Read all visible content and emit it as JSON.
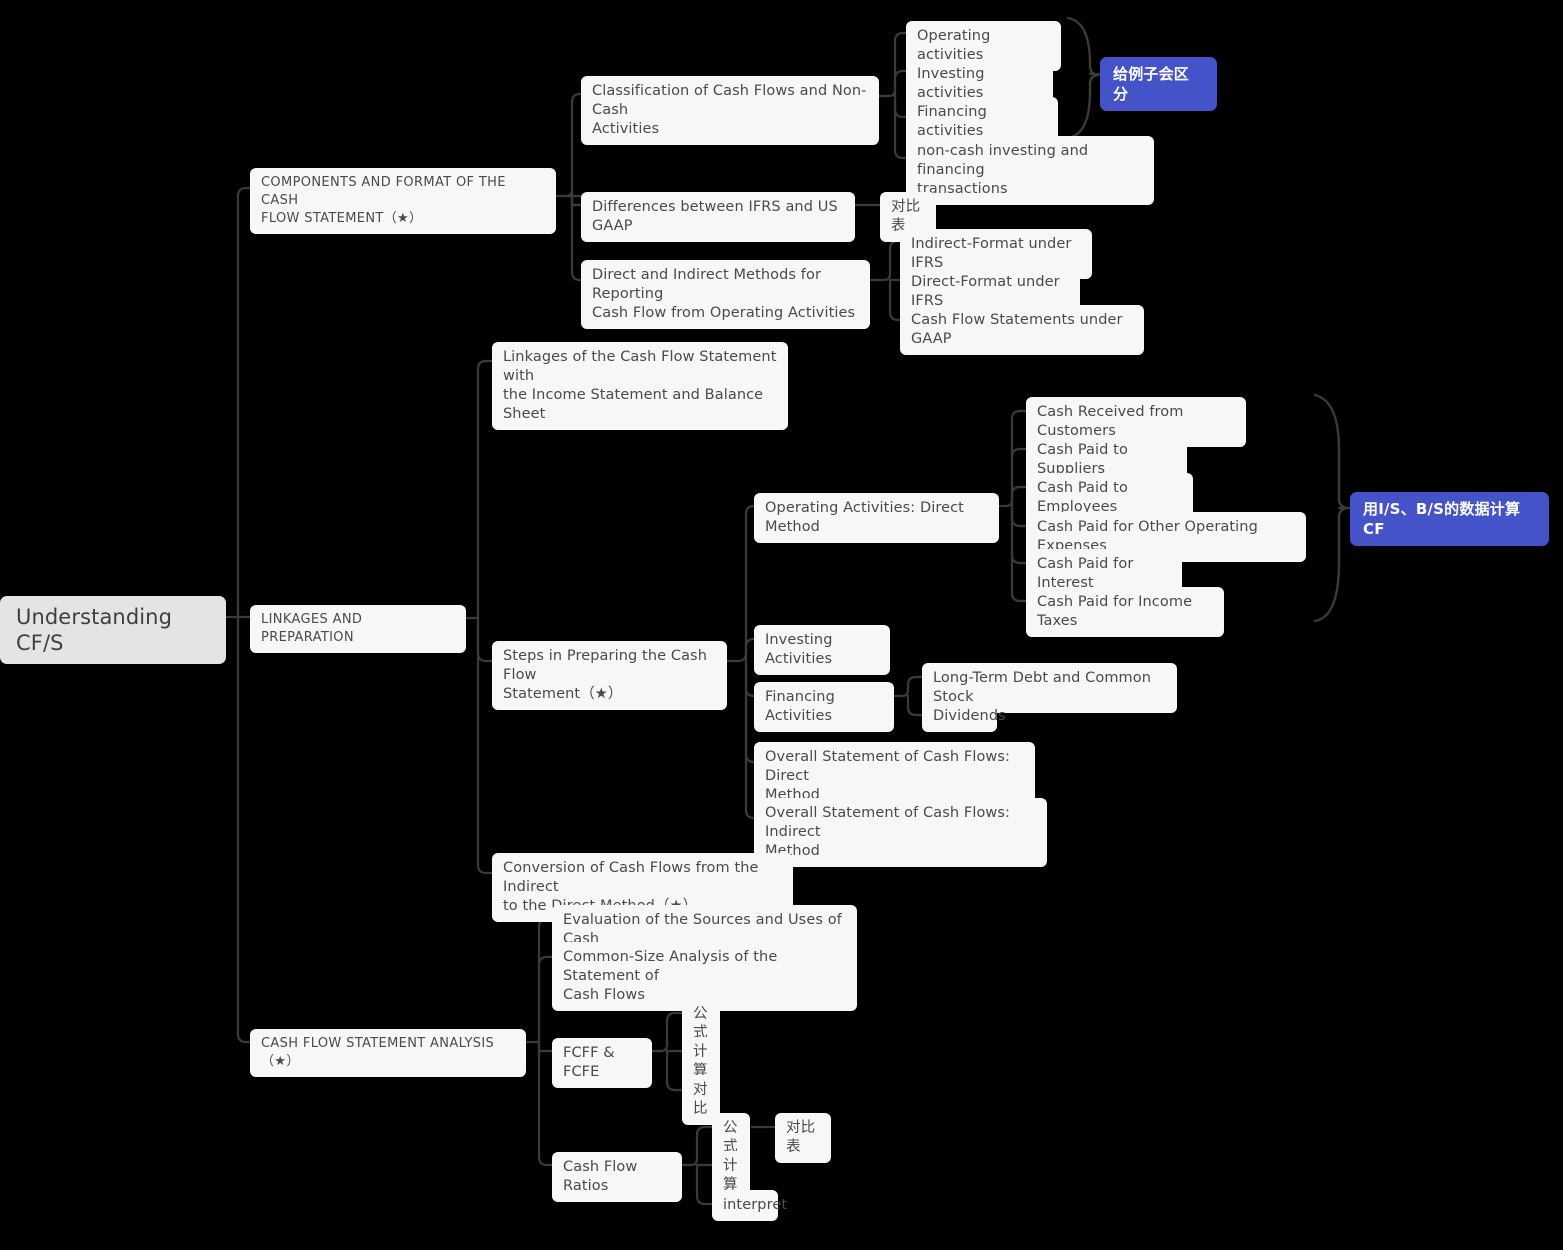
{
  "meta": {
    "title": "Understanding CF/S",
    "background_color": "#000000",
    "node_color": "#f7f7f7",
    "root_color": "#e4e4e4",
    "text_color": "#4a4a4a",
    "badge_color": "#4553c9",
    "edge_color": "#3a3a3a"
  },
  "root": {
    "label": "Understanding CF/S"
  },
  "branches": {
    "components": {
      "label": "COMPONENTS AND FORMAT OF THE CASH\nFLOW  STATEMENT（★）"
    },
    "linkages": {
      "label": "LINKAGES AND PREPARATION"
    },
    "analysis": {
      "label": "CASH FLOW STATEMENT ANALYSIS（★）"
    }
  },
  "nodes": {
    "classification": {
      "label": "Classification of Cash Flows and Non-Cash\nActivities"
    },
    "operating_activities": {
      "label": "Operating activities"
    },
    "investing_activities": {
      "label": "Investing activities"
    },
    "financing_activities": {
      "label": "Financing activities"
    },
    "non_cash": {
      "label": " non-cash investing and financing\ntransactions"
    },
    "badge_examples": {
      "label": "给例子会区分"
    },
    "differences": {
      "label": "Differences between IFRS and US GAAP"
    },
    "comparison_table_1": {
      "label": "对比表"
    },
    "direct_indirect_methods": {
      "label": "Direct and Indirect Methods for Reporting\nCash Flow from Operating Activities"
    },
    "indirect_ifrs": {
      "label": "Indirect-Format under IFRS"
    },
    "direct_ifrs": {
      "label": "Direct-Format under IFRS"
    },
    "cfs_gaap": {
      "label": "Cash Flow Statements under GAAP"
    },
    "linkages_cfs": {
      "label": "Linkages of the Cash Flow Statement with\nthe Income Statement and Balance Sheet"
    },
    "steps_preparing": {
      "label": "Steps in Preparing the Cash Flow\nStatement（★）"
    },
    "operating_direct": {
      "label": "Operating Activities: Direct Method"
    },
    "cash_received_customers": {
      "label": "Cash Received from Customers"
    },
    "cash_paid_suppliers": {
      "label": "Cash Paid to Suppliers"
    },
    "cash_paid_employees": {
      "label": "Cash Paid to Employees"
    },
    "cash_paid_other_operating": {
      "label": "Cash Paid for Other Operating Expenses"
    },
    "cash_paid_interest": {
      "label": "Cash Paid for Interest"
    },
    "cash_paid_income_taxes": {
      "label": "Cash Paid for Income Taxes"
    },
    "badge_compute_cf": {
      "label": "用I/S、B/S的数据计算CF"
    },
    "investing": {
      "label": "Investing Activities"
    },
    "financing": {
      "label": "Financing Activities"
    },
    "longterm_debt": {
      "label": "Long-Term Debt and Common Stock"
    },
    "dividends": {
      "label": "Dividends"
    },
    "overall_direct": {
      "label": "Overall Statement of Cash Flows: Direct\nMethod"
    },
    "overall_indirect": {
      "label": "Overall Statement of Cash Flows: Indirect\nMethod"
    },
    "conversion": {
      "label": "Conversion of Cash Flows from the Indirect\nto the Direct Method（★）"
    },
    "evaluation_sources": {
      "label": "Evaluation of the Sources and Uses of Cash"
    },
    "common_size": {
      "label": "Common-Size Analysis of the Statement of\nCash Flows"
    },
    "fcff_fcfe": {
      "label": "FCFF & FCFE"
    },
    "fcff_formula": {
      "label": "公式"
    },
    "fcff_calc": {
      "label": "计算"
    },
    "fcff_compare": {
      "label": "对比"
    },
    "cash_flow_ratios": {
      "label": "Cash Flow Ratios"
    },
    "ratios_formula": {
      "label": "公式"
    },
    "ratios_comparison_table": {
      "label": "对比表"
    },
    "ratios_calc": {
      "label": "计算"
    },
    "ratios_interpret": {
      "label": "interpret"
    }
  }
}
